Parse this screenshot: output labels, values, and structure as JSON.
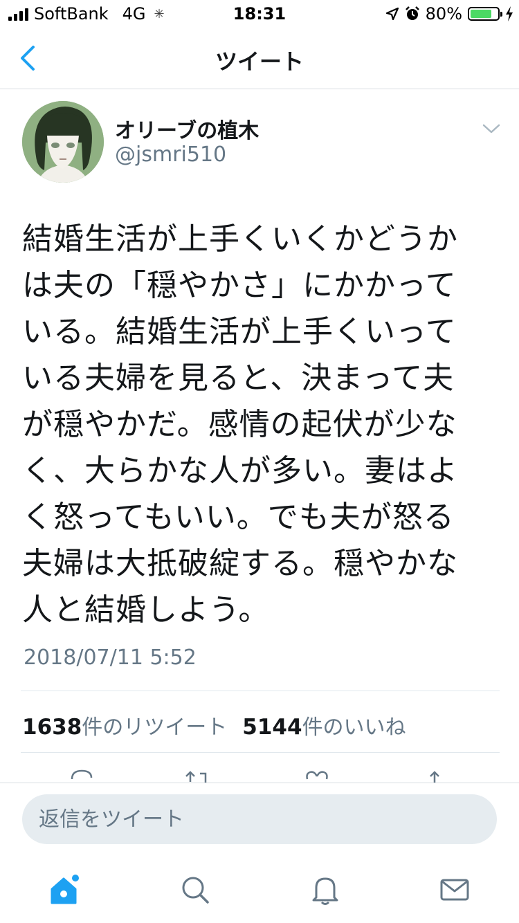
{
  "status_bar": {
    "carrier": "SoftBank",
    "network": "4G",
    "time": "18:31",
    "battery_percent": "80%",
    "battery_level": 0.8,
    "icons": [
      "signal-icon",
      "loading-spinner-icon",
      "location-arrow-icon",
      "alarm-icon",
      "battery-icon",
      "charging-bolt-icon"
    ]
  },
  "nav": {
    "title": "ツイート",
    "back_icon": "chevron-left-icon"
  },
  "tweet": {
    "display_name": "オリーブの植木",
    "username": "@jsmri510",
    "text_lines": [
      "結婚生活が上手くいくかどうか",
      "は夫の「穏やかさ」にかかって",
      "いる。結婚生活が上手くいって",
      "いる夫婦を見ると、決まって夫",
      "が穏やかだ。感情の起伏が少な",
      "く、大らかな人が多い。妻はよ",
      "く怒ってもいい。でも夫が怒る",
      "夫婦は大抵破綻する。穏やかな",
      "人と結婚しよう。"
    ],
    "timestamp": "2018/07/11 5:52",
    "retweets": {
      "count": "1638",
      "label": "件のリツイート"
    },
    "likes": {
      "count": "5144",
      "label": "件のいいね"
    }
  },
  "reply": {
    "placeholder": "返信をツイート"
  },
  "tabs": [
    {
      "name": "home",
      "icon": "home-icon",
      "active": true
    },
    {
      "name": "search",
      "icon": "search-icon",
      "active": false
    },
    {
      "name": "notifications",
      "icon": "bell-icon",
      "active": false
    },
    {
      "name": "messages",
      "icon": "envelope-icon",
      "active": false
    }
  ],
  "colors": {
    "accent": "#1da1f2",
    "text_primary": "#14171a",
    "text_secondary": "#657786",
    "battery": "#4cd964"
  }
}
